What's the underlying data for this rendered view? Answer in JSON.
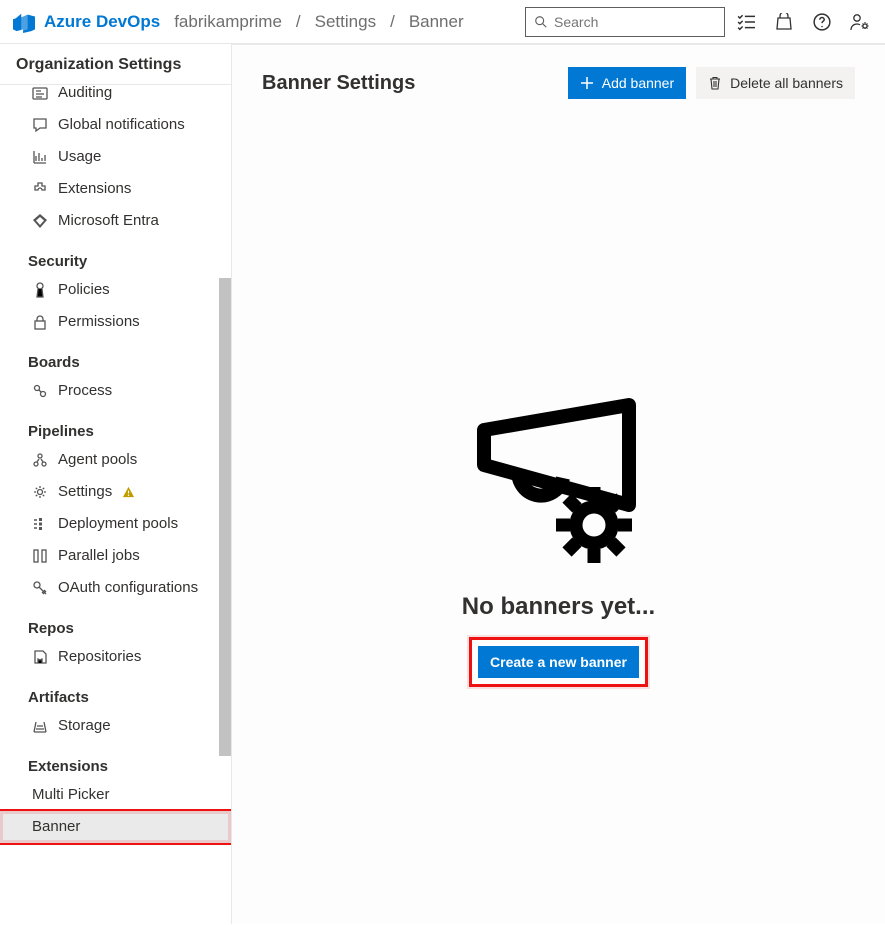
{
  "brand": "Azure DevOps",
  "breadcrumbs": [
    "fabrikamprime",
    "Settings",
    "Banner"
  ],
  "search": {
    "placeholder": "Search"
  },
  "sidebar": {
    "title": "Organization Settings",
    "groups": [
      {
        "heading": null,
        "items": [
          {
            "icon": "audit-icon",
            "label": "Auditing"
          },
          {
            "icon": "chat-icon",
            "label": "Global notifications"
          },
          {
            "icon": "usage-icon",
            "label": "Usage"
          },
          {
            "icon": "extensions-icon",
            "label": "Extensions"
          },
          {
            "icon": "entra-icon",
            "label": "Microsoft Entra"
          }
        ]
      },
      {
        "heading": "Security",
        "items": [
          {
            "icon": "policy-icon",
            "label": "Policies"
          },
          {
            "icon": "lock-icon",
            "label": "Permissions"
          }
        ]
      },
      {
        "heading": "Boards",
        "items": [
          {
            "icon": "process-icon",
            "label": "Process"
          }
        ]
      },
      {
        "heading": "Pipelines",
        "items": [
          {
            "icon": "pools-icon",
            "label": "Agent pools"
          },
          {
            "icon": "gear-icon",
            "label": "Settings",
            "warn": true
          },
          {
            "icon": "deploy-icon",
            "label": "Deployment pools"
          },
          {
            "icon": "parallel-icon",
            "label": "Parallel jobs"
          },
          {
            "icon": "key-icon",
            "label": "OAuth configurations"
          }
        ]
      },
      {
        "heading": "Repos",
        "items": [
          {
            "icon": "repo-icon",
            "label": "Repositories"
          }
        ]
      },
      {
        "heading": "Artifacts",
        "items": [
          {
            "icon": "storage-icon",
            "label": "Storage"
          }
        ]
      },
      {
        "heading": "Extensions",
        "items": [
          {
            "icon": null,
            "label": "Multi Picker"
          },
          {
            "icon": null,
            "label": "Banner",
            "selected": true,
            "highlight": true
          }
        ]
      }
    ]
  },
  "page": {
    "title": "Banner Settings",
    "addLabel": "Add banner",
    "deleteLabel": "Delete all banners"
  },
  "empty": {
    "title": "No banners yet...",
    "cta": "Create a new banner"
  }
}
